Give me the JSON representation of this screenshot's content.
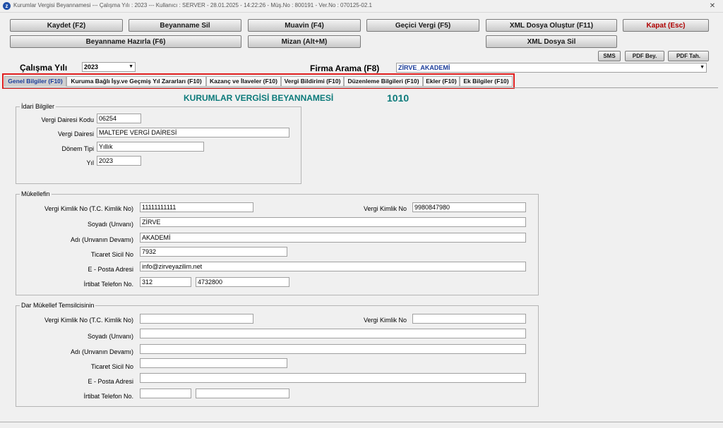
{
  "window": {
    "title": "Kurumlar Vergisi Beyannamesi  ---  Çalışma Yılı : 2023  ---  Kullanıcı : SERVER - 28.01.2025 - 14:22:26 - Müş.No : 800191 - Ver.No : 070125-02.1",
    "close": "✕"
  },
  "toolbar": {
    "kaydet": "Kaydet (F2)",
    "beyanname_sil": "Beyanname Sil",
    "muavin": "Muavin (F4)",
    "gecici_vergi": "Geçici Vergi (F5)",
    "xml_olustur": "XML Dosya Oluştur (F11)",
    "kapat": "Kapat (Esc)",
    "beyanname_hazirla": "Beyanname Hazırla (F6)",
    "mizan": "Mizan (Alt+M)",
    "xml_sil": "XML Dosya Sil",
    "sms": "SMS",
    "pdf_bey": "PDF Bey.",
    "pdf_tah": "PDF Tah."
  },
  "filters": {
    "calisma_yili_label": "Çalışma Yılı",
    "calisma_yili_value": "2023",
    "firma_label": "Firma Arama (F8)",
    "firma_value": "ZİRVE_AKADEMİ"
  },
  "tabs": [
    {
      "label": "Genel Bilgiler (F10)",
      "active": true
    },
    {
      "label": "Kuruma Bağlı İşy.ve Geçmiş Yıl Zararları (F10)",
      "active": false
    },
    {
      "label": "Kazanç ve İlaveler (F10)",
      "active": false
    },
    {
      "label": "Vergi Bildirimi (F10)",
      "active": false
    },
    {
      "label": "Düzenleme Bilgileri (F10)",
      "active": false
    },
    {
      "label": "Ekler (F10)",
      "active": false
    },
    {
      "label": "Ek Bilgiler (F10)",
      "active": false
    }
  ],
  "form": {
    "heading": "KURUMLAR VERGİSİ BEYANNAMESİ",
    "code": "1010"
  },
  "idari": {
    "title": "İdari Bilgiler",
    "vd_kodu_label": "Vergi Dairesi Kodu",
    "vd_kodu": "06254",
    "vd_label": "Vergi Dairesi",
    "vd": "MALTEPE VERGİ DAİRESİ",
    "donem_label": "Dönem Tipi",
    "donem": "Yıllık",
    "yil_label": "Yıl",
    "yil": "2023"
  },
  "mukellef": {
    "title": "Mükellefin",
    "vkn_tc_label": "Vergi Kimlik No (T.C. Kimlik No)",
    "vkn_tc": "11111111111",
    "vkn_label": "Vergi Kimlik No",
    "vkn": "9980847980",
    "soyadi_label": "Soyadı (Unvanı)",
    "soyadi": "ZİRVE",
    "adi_label": "Adı (Unvanın Devamı)",
    "adi": "AKADEMİ",
    "sicil_label": "Ticaret Sicil No",
    "sicil": "7932",
    "eposta_label": "E - Posta Adresi",
    "eposta": "info@zirveyazilim.net",
    "tel_label": "İrtibat Telefon No.",
    "tel_alan": "312",
    "tel_no": "4732800"
  },
  "temsilci": {
    "title": "Dar Mükellef Temsilcisinin",
    "vkn_tc_label": "Vergi Kimlik No (T.C. Kimlik No)",
    "vkn_tc": "",
    "vkn_label": "Vergi Kimlik No",
    "vkn": "",
    "soyadi_label": "Soyadı (Unvanı)",
    "soyadi": "",
    "adi_label": "Adı (Unvanın Devamı)",
    "adi": "",
    "sicil_label": "Ticaret Sicil No",
    "sicil": "",
    "eposta_label": "E - Posta Adresi",
    "eposta": "",
    "tel_label": "İrtibat Telefon No.",
    "tel_alan": "",
    "tel_no": ""
  },
  "colors": {
    "heading": "#0b7a7a",
    "active_tab_text": "#1a3c9a",
    "kapat_text": "#b00000",
    "highlight_frame": "#e02020"
  }
}
